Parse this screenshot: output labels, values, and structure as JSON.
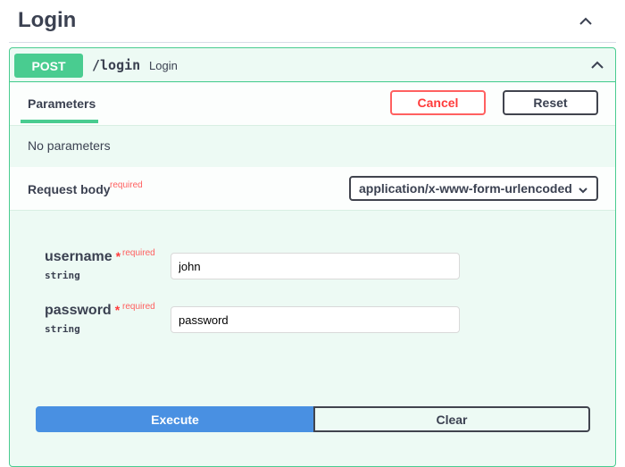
{
  "section": {
    "title": "Login",
    "collapse_icon": "chevron-up-icon"
  },
  "operation": {
    "method": "POST",
    "path": "/login",
    "description": "Login",
    "collapse_icon": "chevron-up-icon",
    "method_color": "#49cc90"
  },
  "parameters": {
    "tab_label": "Parameters",
    "cancel_label": "Cancel",
    "reset_label": "Reset",
    "empty_text": "No parameters"
  },
  "request_body": {
    "label": "Request body",
    "required_text": "required",
    "content_type": "application/x-www-form-urlencoded",
    "dropdown_icon": "chevron-down-icon"
  },
  "fields": [
    {
      "name": "username",
      "star": "*",
      "required_text": "required",
      "type": "string",
      "value": "john"
    },
    {
      "name": "password",
      "star": "*",
      "required_text": "required",
      "type": "string",
      "value": "password"
    }
  ],
  "actions": {
    "execute_label": "Execute",
    "clear_label": "Clear",
    "execute_color": "#4990e2"
  }
}
